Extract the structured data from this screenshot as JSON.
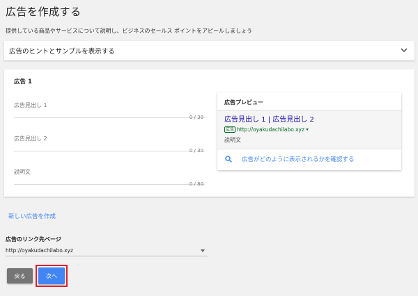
{
  "page": {
    "title": "広告を作成する",
    "subtitle": "提供している商品やサービスについて説明し、ビジネスのセールス ポイントをアピールしましょう"
  },
  "hint_dropdown": {
    "label": "広告のヒントとサンプルを表示する",
    "icon": "chevron-down-icon"
  },
  "ad_card": {
    "title": "広告 1",
    "fields": [
      {
        "label": "広告見出し 1",
        "value": "",
        "counter": "0 / 30"
      },
      {
        "label": "広告見出し 2",
        "value": "",
        "counter": "0 / 30"
      },
      {
        "label": "説明文",
        "value": "",
        "counter": "0 / 80"
      }
    ]
  },
  "preview": {
    "header": "広告プレビュー",
    "headline": "広告見出し 1 | 広告見出し 2",
    "badge": "広告",
    "url": "http://oyakudachilabo.xyz",
    "description": "説明文",
    "link_label": "広告がどのように表示されるかを確認する",
    "link_icon": "search-icon"
  },
  "new_ad_link": "新しい広告を作成",
  "landing_page": {
    "label": "広告のリンク先ページ",
    "selected": "http://oyakudachilabo.xyz"
  },
  "buttons": {
    "back": "戻る",
    "next": "次へ"
  },
  "colors": {
    "accent": "#4285f4",
    "link": "#1a0dab",
    "url_green": "#006621",
    "highlight": "#e0202b",
    "back_button": "#757575"
  }
}
